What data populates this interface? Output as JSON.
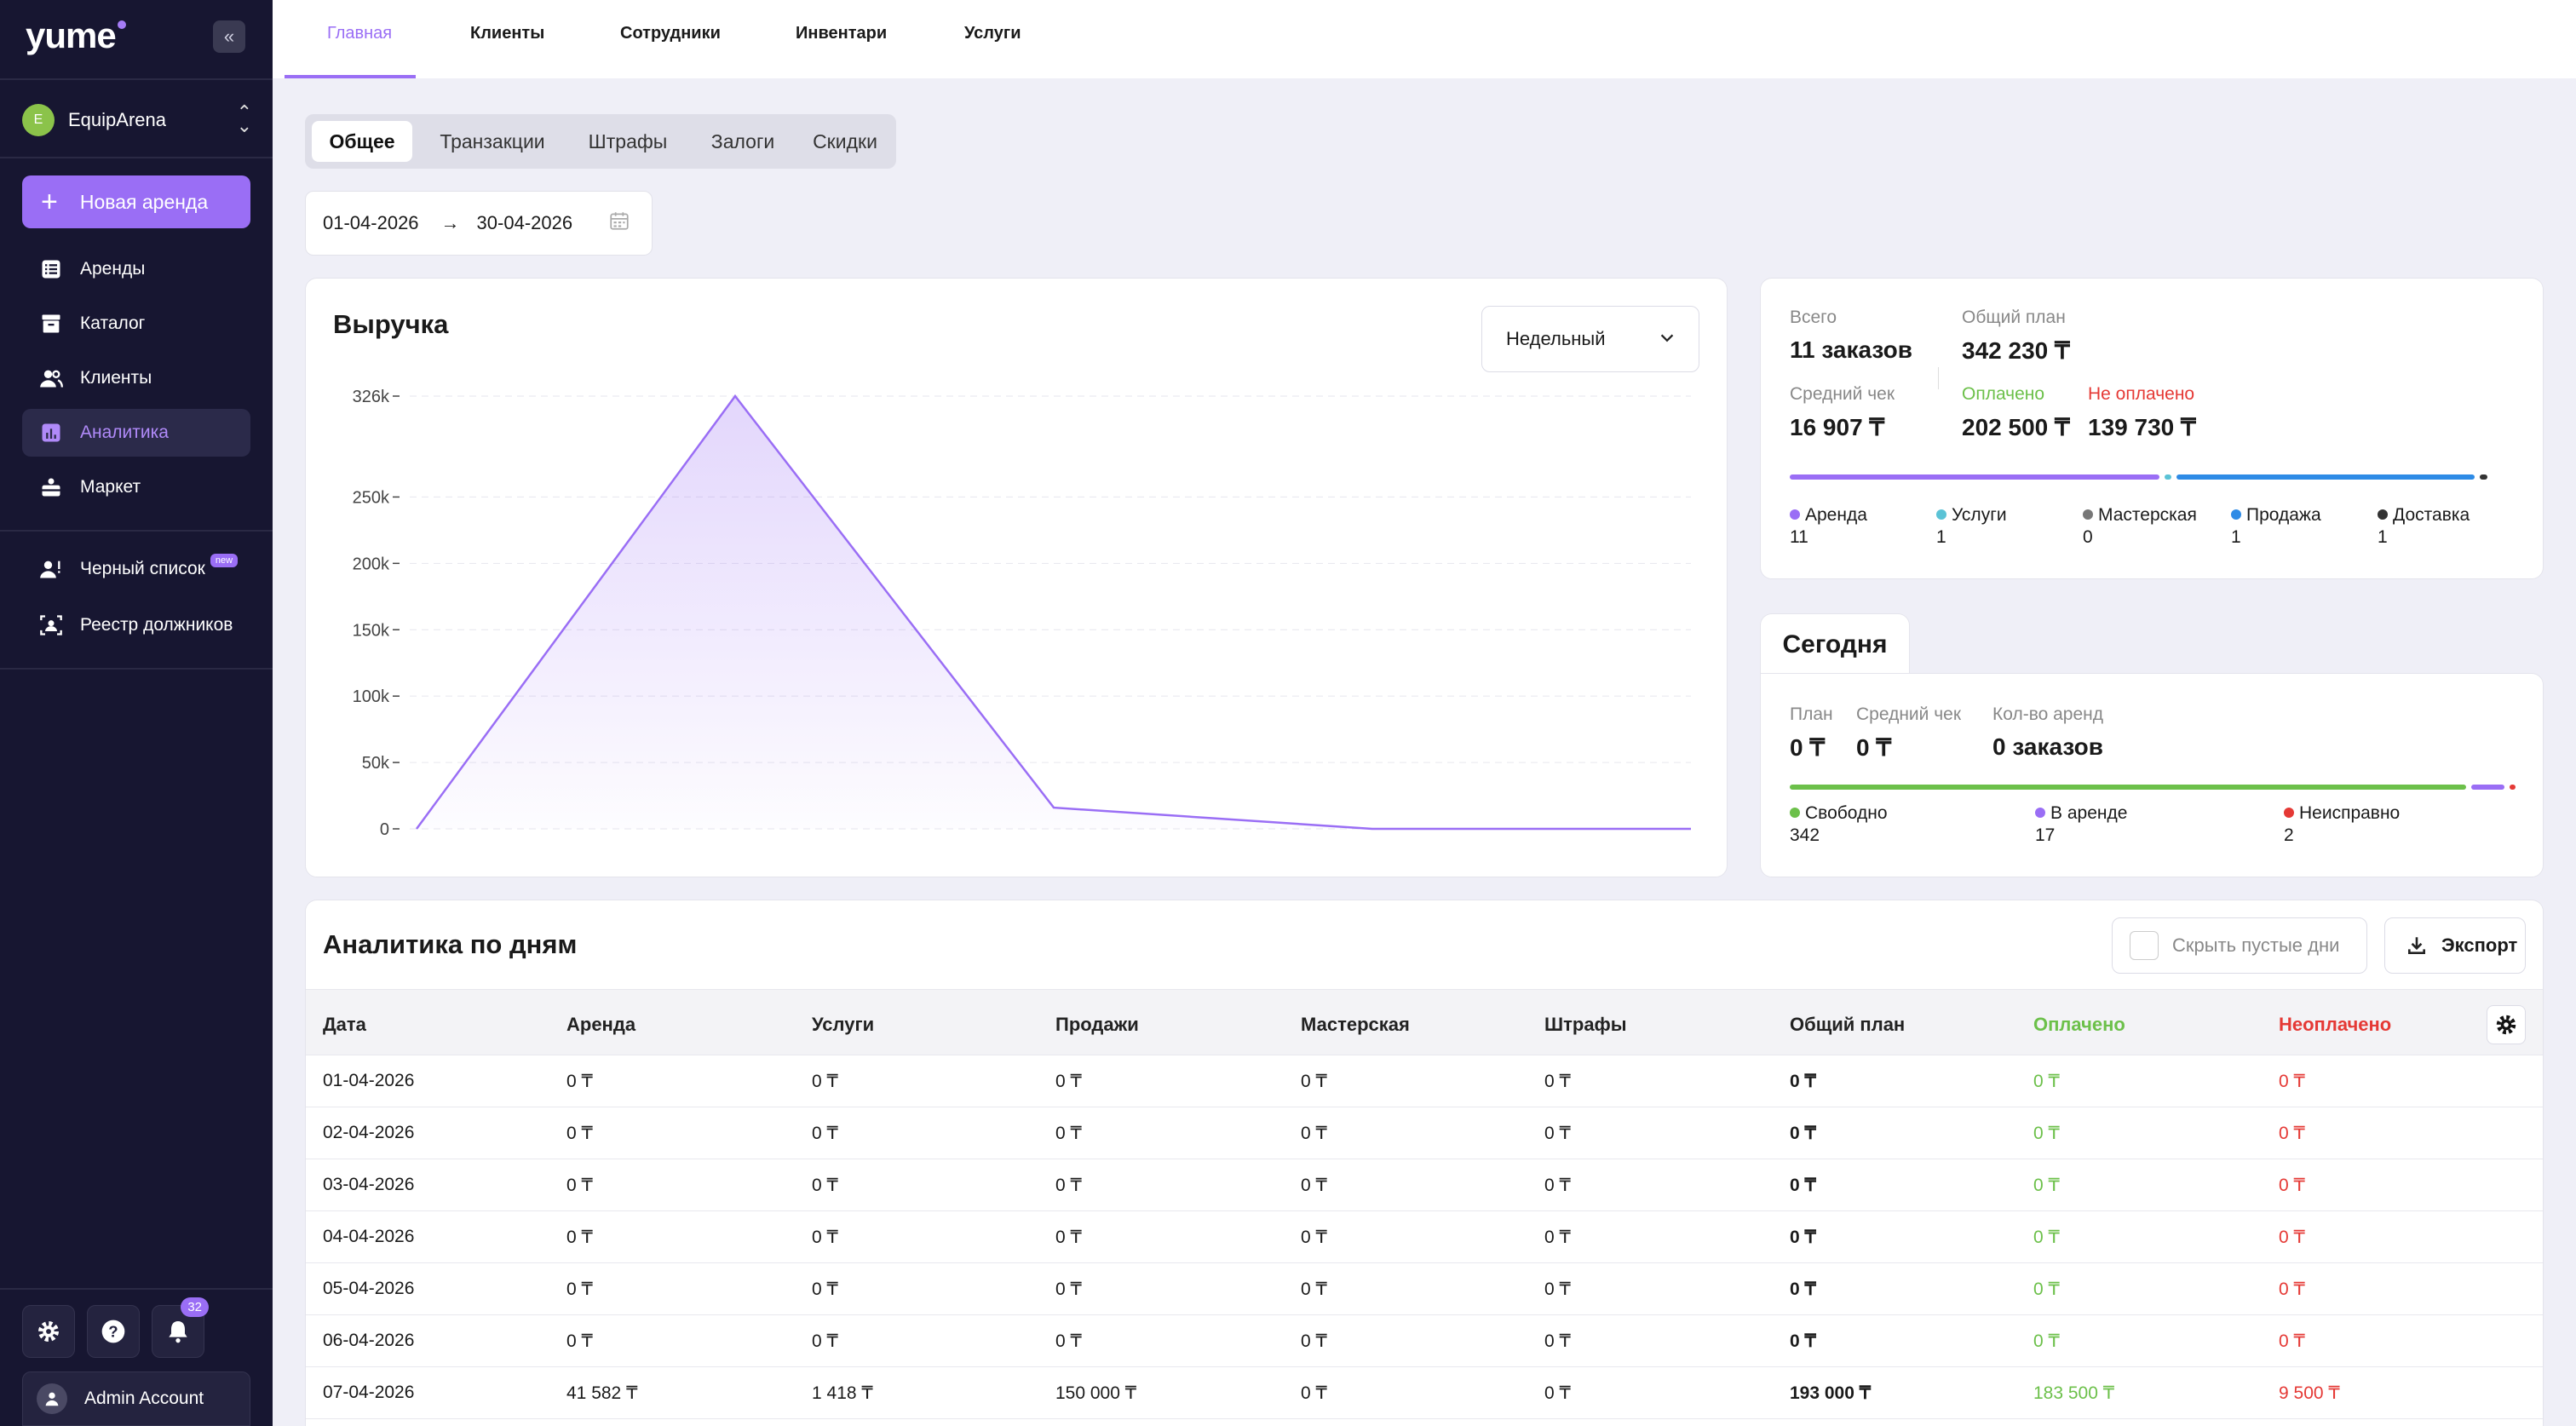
{
  "sidebar": {
    "logo": "yume",
    "org": {
      "initial": "E",
      "name": "EquipArena"
    },
    "new_rent_label": "Новая аренда",
    "items": [
      {
        "label": "Аренды",
        "icon": "rentals-list-icon"
      },
      {
        "label": "Каталог",
        "icon": "catalog-box-icon"
      },
      {
        "label": "Клиенты",
        "icon": "users-icon"
      },
      {
        "label": "Аналитика",
        "icon": "analytics-icon",
        "active": true
      },
      {
        "label": "Маркет",
        "icon": "market-icon"
      }
    ],
    "extra_items": [
      {
        "label": "Черный список",
        "badge": "new",
        "icon": "blacklist-user-icon"
      },
      {
        "label": "Реестр должников",
        "icon": "debtors-registry-icon"
      }
    ],
    "notifications_count": "32",
    "account_name": "Admin Account"
  },
  "top_tabs": [
    {
      "label": "Главная",
      "active": true
    },
    {
      "label": "Клиенты"
    },
    {
      "label": "Сотрудники"
    },
    {
      "label": "Инвентари"
    },
    {
      "label": "Услуги"
    }
  ],
  "sub_tabs": [
    {
      "label": "Общее",
      "active": true
    },
    {
      "label": "Транзакции"
    },
    {
      "label": "Штрафы"
    },
    {
      "label": "Залоги"
    },
    {
      "label": "Скидки"
    }
  ],
  "date_range": {
    "from": "01-04-2026",
    "to": "30-04-2026"
  },
  "revenue": {
    "title": "Выручка",
    "period": "Недельный",
    "chart_data": {
      "type": "area",
      "title": "Выручка",
      "y_ticks": [
        "0",
        "50k",
        "100k",
        "150k",
        "200k",
        "250k",
        "326k"
      ],
      "y_tick_values": [
        0,
        50000,
        100000,
        150000,
        200000,
        250000,
        326000
      ],
      "ylim": [
        0,
        326000
      ],
      "x_labels": [],
      "values": [
        0,
        326000,
        16000,
        0,
        0
      ],
      "color": "#9a6ef5",
      "grid": true
    }
  },
  "summary": {
    "total_label": "Всего",
    "total_value": "11 заказов",
    "plan_label": "Общий план",
    "plan_value": "342 230 ₸",
    "avg_label": "Средний чек",
    "avg_value": "16 907 ₸",
    "paid_label": "Оплачено",
    "paid_value": "202 500 ₸",
    "unpaid_label": "Не оплачено",
    "unpaid_value": "139 730 ₸",
    "segments": [
      {
        "color": "#9a6ef5",
        "fraction": 0.52
      },
      {
        "color": "#5bc3d6",
        "fraction": 0.01
      },
      {
        "color": "#2e8be6",
        "fraction": 0.42
      },
      {
        "color": "#333333",
        "fraction": 0.01
      }
    ],
    "legend": [
      {
        "label": "Аренда",
        "count": "11",
        "color": "#9a6ef5"
      },
      {
        "label": "Услуги",
        "count": "1",
        "color": "#5bc3d6"
      },
      {
        "label": "Мастерская",
        "count": "0",
        "color": "#777777"
      },
      {
        "label": "Продажа",
        "count": "1",
        "color": "#2e8be6"
      },
      {
        "label": "Доставка",
        "count": "1",
        "color": "#333333"
      }
    ]
  },
  "today": {
    "title": "Сегодня",
    "plan_label": "План",
    "plan_value": "0 ₸",
    "avg_label": "Средний чек",
    "avg_value": "0 ₸",
    "count_label": "Кол-во аренд",
    "count_value": "0 заказов",
    "segments": [
      {
        "color": "#6cc04a",
        "fraction": 0.945
      },
      {
        "color": "#9a6ef5",
        "fraction": 0.047
      },
      {
        "color": "#e53935",
        "fraction": 0.008
      }
    ],
    "legend": [
      {
        "label": "Свободно",
        "count": "342",
        "color": "#6cc04a"
      },
      {
        "label": "В аренде",
        "count": "17",
        "color": "#9a6ef5"
      },
      {
        "label": "Неисправно",
        "count": "2",
        "color": "#e53935"
      }
    ]
  },
  "daily": {
    "title": "Аналитика по дням",
    "hide_empty_label": "Скрыть пустые дни",
    "export_label": "Экспорт",
    "columns": [
      "Дата",
      "Аренда",
      "Услуги",
      "Продажи",
      "Мастерская",
      "Штрафы",
      "Общий план",
      "Оплачено",
      "Неоплачено"
    ],
    "rows": [
      [
        "01-04-2026",
        "0 ₸",
        "0 ₸",
        "0 ₸",
        "0 ₸",
        "0 ₸",
        "0 ₸",
        "0 ₸",
        "0 ₸"
      ],
      [
        "02-04-2026",
        "0 ₸",
        "0 ₸",
        "0 ₸",
        "0 ₸",
        "0 ₸",
        "0 ₸",
        "0 ₸",
        "0 ₸"
      ],
      [
        "03-04-2026",
        "0 ₸",
        "0 ₸",
        "0 ₸",
        "0 ₸",
        "0 ₸",
        "0 ₸",
        "0 ₸",
        "0 ₸"
      ],
      [
        "04-04-2026",
        "0 ₸",
        "0 ₸",
        "0 ₸",
        "0 ₸",
        "0 ₸",
        "0 ₸",
        "0 ₸",
        "0 ₸"
      ],
      [
        "05-04-2026",
        "0 ₸",
        "0 ₸",
        "0 ₸",
        "0 ₸",
        "0 ₸",
        "0 ₸",
        "0 ₸",
        "0 ₸"
      ],
      [
        "06-04-2026",
        "0 ₸",
        "0 ₸",
        "0 ₸",
        "0 ₸",
        "0 ₸",
        "0 ₸",
        "0 ₸",
        "0 ₸"
      ],
      [
        "07-04-2026",
        "41 582 ₸",
        "1 418 ₸",
        "150 000 ₸",
        "0 ₸",
        "0 ₸",
        "193 000 ₸",
        "183 500 ₸",
        "9 500 ₸"
      ]
    ]
  }
}
